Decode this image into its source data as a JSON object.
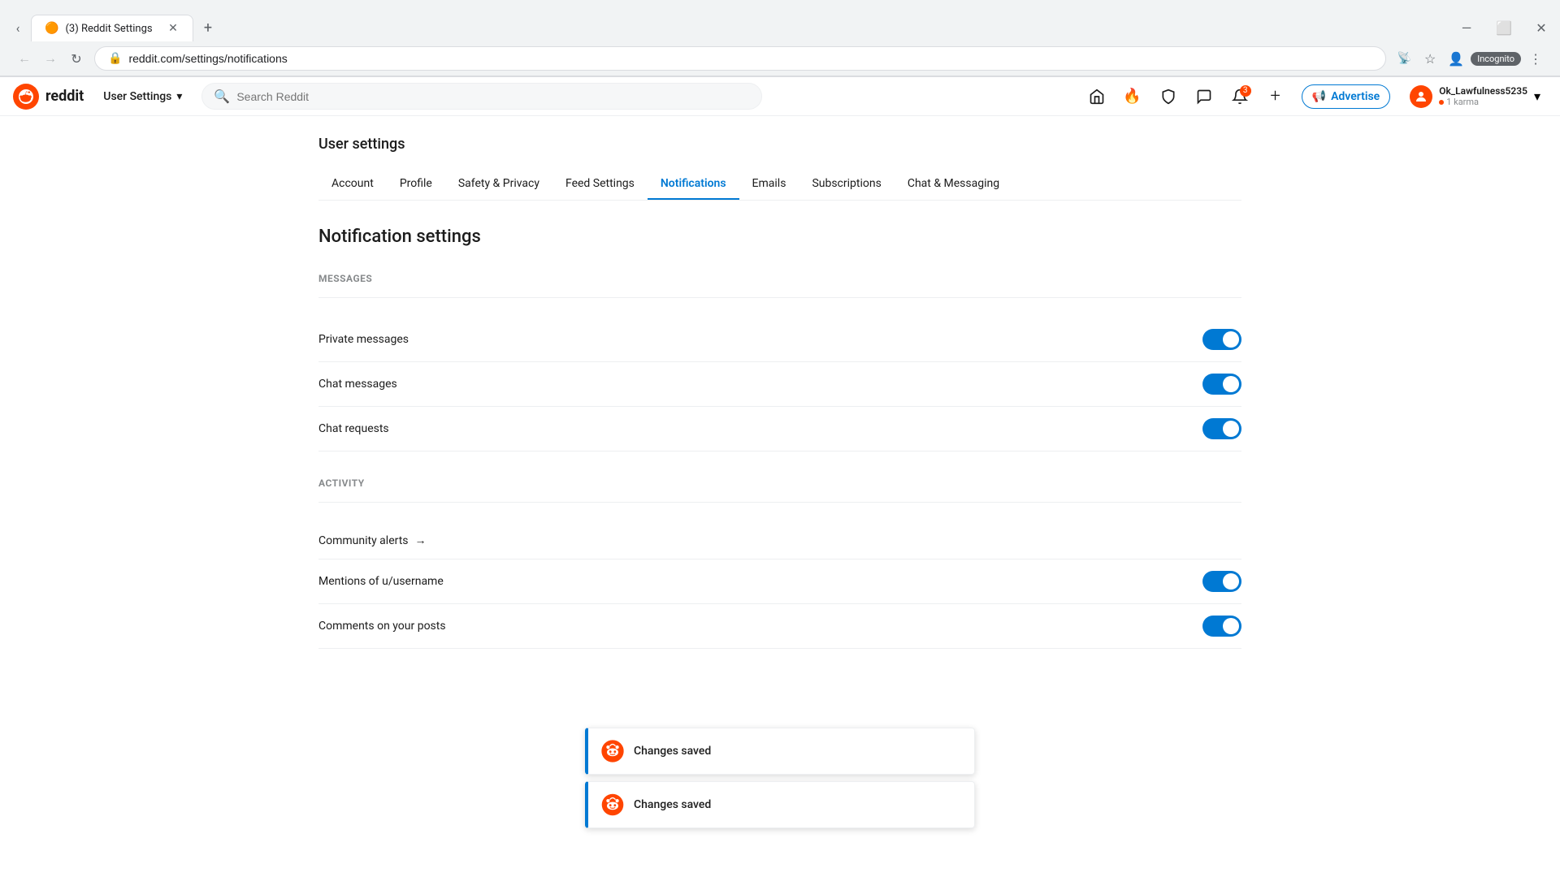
{
  "browser": {
    "tab_favicon": "🟠",
    "tab_title": "(3) Reddit Settings",
    "new_tab_icon": "+",
    "address": "reddit.com/settings/notifications",
    "incognito_label": "Incognito",
    "window_minimize": "—",
    "window_maximize": "⬜",
    "window_close": "✕"
  },
  "header": {
    "logo_text": "reddit",
    "user_settings_label": "User Settings",
    "search_placeholder": "Search Reddit",
    "advertise_label": "Advertise",
    "username": "Ok_Lawfulness5235",
    "karma": "1 karma",
    "notif_count": "3"
  },
  "page": {
    "title": "User settings",
    "tabs": [
      {
        "id": "account",
        "label": "Account",
        "active": false
      },
      {
        "id": "profile",
        "label": "Profile",
        "active": false
      },
      {
        "id": "safety-privacy",
        "label": "Safety & Privacy",
        "active": false
      },
      {
        "id": "feed-settings",
        "label": "Feed Settings",
        "active": false
      },
      {
        "id": "notifications",
        "label": "Notifications",
        "active": true
      },
      {
        "id": "emails",
        "label": "Emails",
        "active": false
      },
      {
        "id": "subscriptions",
        "label": "Subscriptions",
        "active": false
      },
      {
        "id": "chat-messaging",
        "label": "Chat & Messaging",
        "active": false
      }
    ],
    "section_title": "Notification settings",
    "messages_category": "MESSAGES",
    "activity_category": "ACTIVITY",
    "settings": {
      "private_messages": {
        "label": "Private messages",
        "enabled": true
      },
      "chat_messages": {
        "label": "Chat messages",
        "enabled": true
      },
      "chat_requests": {
        "label": "Chat requests",
        "enabled": true
      },
      "community_alerts": {
        "label": "Community alerts",
        "has_arrow": true
      },
      "mentions": {
        "label": "Mentions of u/username",
        "enabled": true
      },
      "comments_on_posts": {
        "label": "Comments on your posts",
        "enabled": true
      }
    }
  },
  "toasts": [
    {
      "text": "Changes saved"
    },
    {
      "text": "Changes saved"
    }
  ]
}
